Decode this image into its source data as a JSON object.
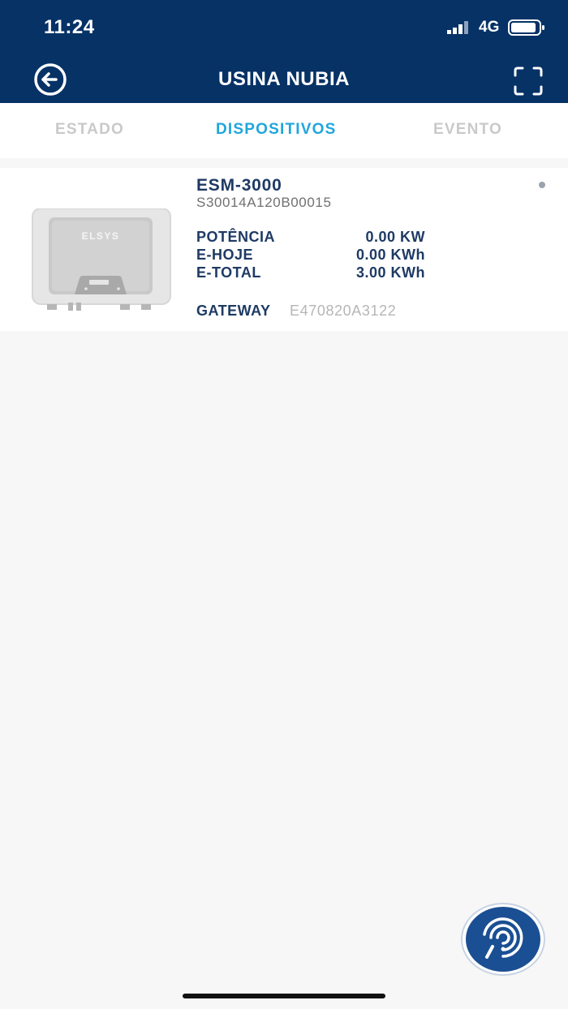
{
  "status_bar": {
    "time": "11:24",
    "network": "4G",
    "icons": [
      "signal-icon",
      "battery-icon"
    ]
  },
  "header": {
    "title": "USINA NUBIA",
    "back_icon": "arrow-left-circle-icon",
    "expand_icon": "fullscreen-icon",
    "background": "#063266"
  },
  "tabs": [
    {
      "label": "ESTADO",
      "active": false
    },
    {
      "label": "DISPOSITIVOS",
      "active": true
    },
    {
      "label": "EVENTO",
      "active": false
    }
  ],
  "devices": [
    {
      "model": "ESM-3000",
      "serial": "S30014A120B00015",
      "image_brand": "ELSYS",
      "metrics": [
        {
          "label": "POTÊNCIA",
          "value": "0.00 KW"
        },
        {
          "label": "E-HOJE",
          "value": "0.00 KWh"
        },
        {
          "label": "E-TOTAL",
          "value": "3.00 KWh"
        }
      ],
      "gateway_label": "GATEWAY",
      "gateway_value": "E470820A3122"
    }
  ],
  "fab": {
    "icon": "chat-support-icon"
  },
  "colors": {
    "accent": "#1fa6dc",
    "text_dark": "#1e3a64",
    "muted": "#c9c9c9"
  }
}
